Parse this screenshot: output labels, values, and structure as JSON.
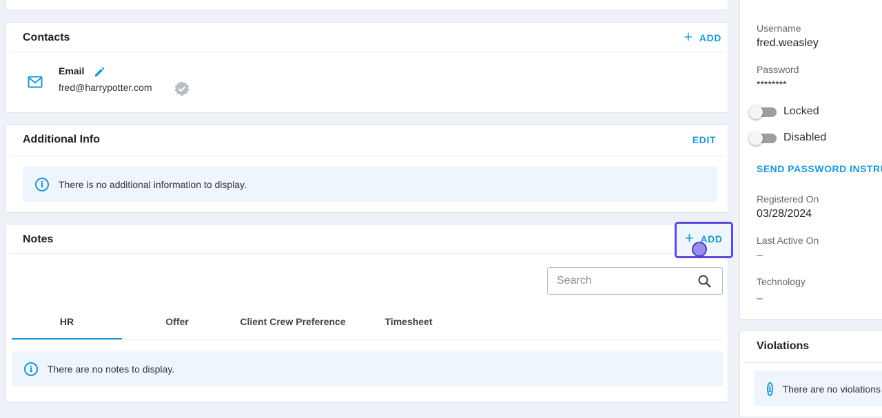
{
  "colors": {
    "accent": "#1a97d6",
    "highlight": "#5b4bdb"
  },
  "contacts": {
    "title": "Contacts",
    "add_label": "ADD",
    "email_label": "Email",
    "email_value": "fred@harrypotter.com"
  },
  "additional_info": {
    "title": "Additional Info",
    "edit_label": "EDIT",
    "empty_message": "There is no additional information to display."
  },
  "notes": {
    "title": "Notes",
    "add_label": "ADD",
    "search_placeholder": "Search",
    "tabs": [
      {
        "label": "HR",
        "active": true
      },
      {
        "label": "Offer"
      },
      {
        "label": "Client Crew Preference"
      },
      {
        "label": "Timesheet"
      }
    ],
    "empty_message": "There are no notes to display."
  },
  "account": {
    "username_label": "Username",
    "username_value": "fred.weasley",
    "password_label": "Password",
    "password_value": "********",
    "locked_label": "Locked",
    "disabled_label": "Disabled",
    "send_password_label": "SEND PASSWORD INSTRUCTIONS",
    "registered_label": "Registered On",
    "registered_value": "03/28/2024",
    "last_active_label": "Last Active On",
    "last_active_value": "–",
    "technology_label": "Technology",
    "technology_value": "–"
  },
  "violations": {
    "title": "Violations",
    "empty_message": "There are no violations to display."
  }
}
